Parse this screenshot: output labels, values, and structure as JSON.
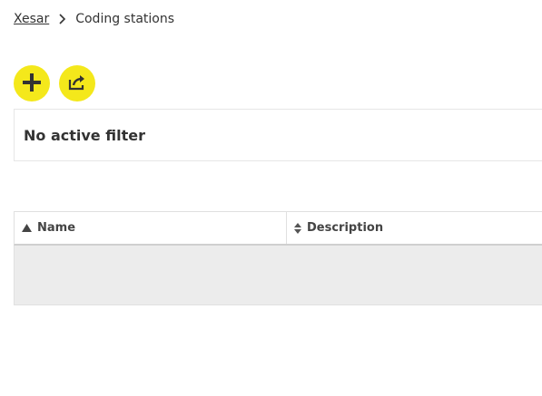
{
  "breadcrumb": {
    "root": "Xesar",
    "separator_icon": "chevron-right-icon",
    "current": "Coding stations"
  },
  "actions": {
    "add_icon": "plus-icon",
    "export_icon": "share-export-icon",
    "accent_color": "#f4e81b"
  },
  "filter": {
    "status": "No active filter"
  },
  "table": {
    "columns": [
      {
        "label": "Name",
        "sort": "ascending",
        "sort_icon": "sort-asc-icon"
      },
      {
        "label": "Description",
        "sort": "none",
        "sort_icon": "sort-both-icon"
      }
    ],
    "rows": []
  }
}
